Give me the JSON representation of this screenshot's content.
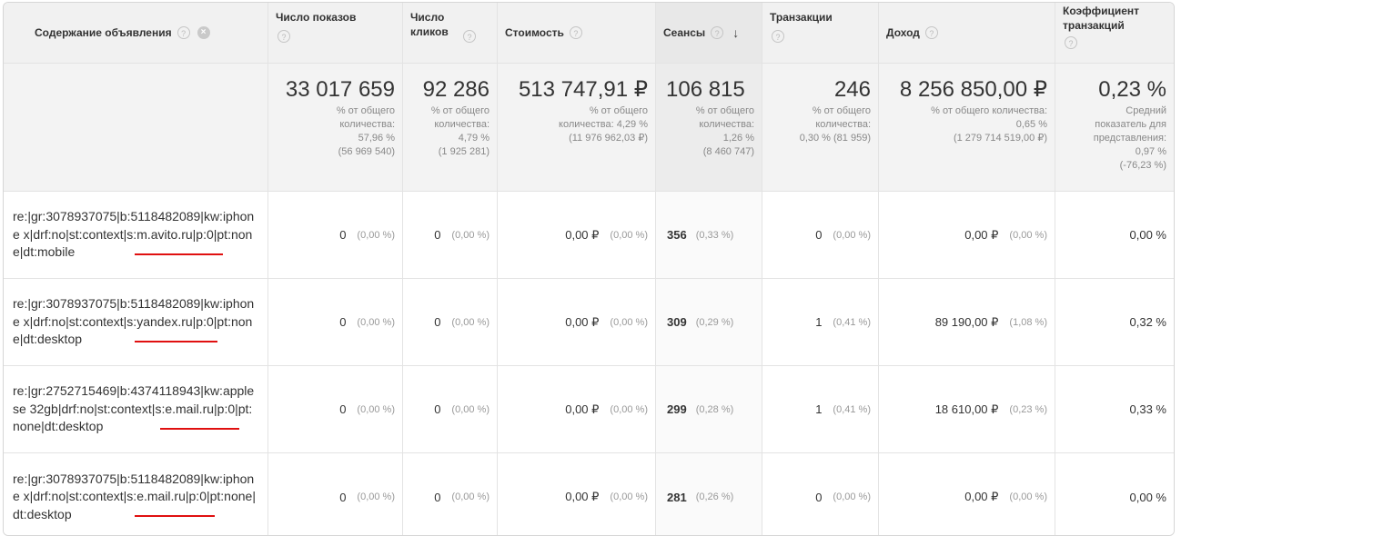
{
  "header": {
    "content": "Содержание объявления",
    "impressions": "Число показов",
    "clicks": "Число кликов",
    "cost": "Стоимость",
    "sessions": "Сеансы",
    "transactions": "Транзакции",
    "revenue": "Доход",
    "conversion": "Коэффициент транзакций",
    "help_glyph": "?",
    "remove_glyph": "×",
    "sort_glyph": "↓"
  },
  "totals": {
    "impressions": {
      "value": "33 017 659",
      "line1": "% от общего",
      "line2": "количества:",
      "line3": "57,96 %",
      "line4": "(56 969 540)"
    },
    "clicks": {
      "value": "92 286",
      "line1": "% от общего",
      "line2": "количества:",
      "line3": "4,79 %",
      "line4": "(1 925 281)"
    },
    "cost": {
      "value": "513 747,91 ₽",
      "line1": "% от общего",
      "line2": "количества: 4,29 %",
      "line3": "(11 976 962,03 ₽)"
    },
    "sessions": {
      "value": "106 815",
      "line1": "% от общего",
      "line2": "количества:",
      "line3": "1,26 %",
      "line4": "(8 460 747)"
    },
    "transactions": {
      "value": "246",
      "line1": "% от общего",
      "line2": "количества:",
      "line3": "0,30 % (81 959)"
    },
    "revenue": {
      "value": "8 256 850,00 ₽",
      "line1": "% от общего количества:",
      "line2": "0,65 %",
      "line3": "(1 279 714 519,00 ₽)"
    },
    "conversion": {
      "value": "0,23 %",
      "line1": "Средний",
      "line2": "показатель для",
      "line3": "представления:",
      "line4": "0,97 %",
      "line5": "(-76,23 %)"
    }
  },
  "rows": [
    {
      "content": "re:|gr:3078937075|b:5118482089|kw:iphone x|drf:no|st:context|s:m.avito.ru|p:0|pt:none|dt:mobile",
      "impressions": "0",
      "impressions_pct": "(0,00 %)",
      "clicks": "0",
      "clicks_pct": "(0,00 %)",
      "cost": "0,00 ₽",
      "cost_pct": "(0,00 %)",
      "sessions": "356",
      "sessions_pct": "(0,33 %)",
      "transactions": "0",
      "transactions_pct": "(0,00 %)",
      "revenue": "0,00 ₽",
      "revenue_pct": "(0,00 %)",
      "conversion": "0,00 %"
    },
    {
      "content": "re:|gr:3078937075|b:5118482089|kw:iphone x|drf:no|st:context|s:yandex.ru|p:0|pt:none|dt:desktop",
      "impressions": "0",
      "impressions_pct": "(0,00 %)",
      "clicks": "0",
      "clicks_pct": "(0,00 %)",
      "cost": "0,00 ₽",
      "cost_pct": "(0,00 %)",
      "sessions": "309",
      "sessions_pct": "(0,29 %)",
      "transactions": "1",
      "transactions_pct": "(0,41 %)",
      "revenue": "89 190,00 ₽",
      "revenue_pct": "(1,08 %)",
      "conversion": "0,32 %"
    },
    {
      "content": "re:|gr:2752715469|b:4374118943|kw:apple se 32gb|drf:no|st:context|s:e.mail.ru|p:0|pt:none|dt:desktop",
      "impressions": "0",
      "impressions_pct": "(0,00 %)",
      "clicks": "0",
      "clicks_pct": "(0,00 %)",
      "cost": "0,00 ₽",
      "cost_pct": "(0,00 %)",
      "sessions": "299",
      "sessions_pct": "(0,28 %)",
      "transactions": "1",
      "transactions_pct": "(0,41 %)",
      "revenue": "18 610,00 ₽",
      "revenue_pct": "(0,23 %)",
      "conversion": "0,33 %"
    },
    {
      "content": "re:|gr:3078937075|b:5118482089|kw:iphone x|drf:no|st:context|s:e.mail.ru|p:0|pt:none|dt:desktop",
      "impressions": "0",
      "impressions_pct": "(0,00 %)",
      "clicks": "0",
      "clicks_pct": "(0,00 %)",
      "cost": "0,00 ₽",
      "cost_pct": "(0,00 %)",
      "sessions": "281",
      "sessions_pct": "(0,26 %)",
      "transactions": "0",
      "transactions_pct": "(0,00 %)",
      "revenue": "0,00 ₽",
      "revenue_pct": "(0,00 %)",
      "conversion": "0,00 %"
    }
  ],
  "colors": {
    "underline": "#e01010",
    "header_bg": "#f1f1f1",
    "totals_bg": "#f3f3f3"
  },
  "icons": {
    "help": "question-circle-icon",
    "remove": "close-circle-icon",
    "sort": "arrow-down-icon"
  }
}
